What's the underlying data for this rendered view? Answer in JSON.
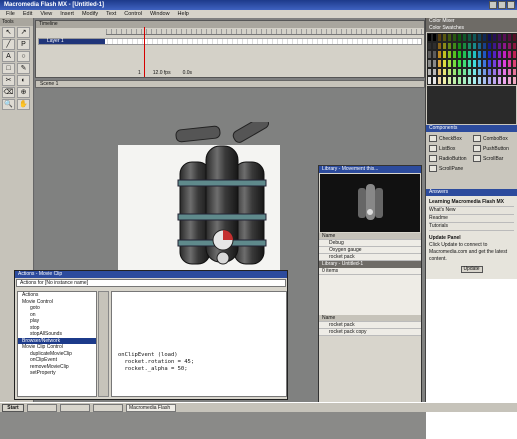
{
  "window": {
    "title": "Macromedia Flash MX - [Untitled-1]"
  },
  "menu": [
    "File",
    "Edit",
    "View",
    "Insert",
    "Modify",
    "Text",
    "Control",
    "Window",
    "Help"
  ],
  "tools": {
    "label": "Tools",
    "glyphs": [
      "↖",
      "↗",
      "╱",
      "P",
      "A",
      "○",
      "□",
      "✎",
      "✂",
      "◐",
      "⌫",
      "⊕",
      "🔍",
      "✋"
    ]
  },
  "timeline": {
    "label": "Timeline",
    "layer": "Layer 1",
    "status": [
      "1",
      "12.0 fps",
      "0.0s"
    ]
  },
  "stage_bar": {
    "scene": "Scene 1"
  },
  "panels": {
    "color_mixer": "Color Mixer",
    "color_swatches": "Color Swatches",
    "components": "Components",
    "component_items": [
      "CheckBox",
      "ComboBox",
      "ListBox",
      "PushButton",
      "RadioButton",
      "ScrollBar",
      "ScrollPane"
    ],
    "answers": "Answers",
    "answers_rows": [
      "Learning Macromedia Flash MX",
      "What's New",
      "Readme",
      "Tutorials"
    ],
    "answers_note_title": "Update Panel",
    "answers_note": "Click Update to connect to Macromedia.com and get the latest content.",
    "update_label": "Update"
  },
  "library": {
    "title": "Library - Movement this...",
    "header_name": "Name",
    "items": [
      "Debug",
      "Oxygen gauge",
      "rocket pack"
    ],
    "second_title": "Library - Untitled-1",
    "second_count": "0 items",
    "third_header": "Name",
    "third_items": [
      "rocket pack",
      "rocket pack copy"
    ]
  },
  "actions": {
    "title": "Actions - Movie Clip",
    "selector": "Actions for [No instance name]",
    "tree": [
      {
        "label": "Actions",
        "cat": true
      },
      {
        "label": "Movie Control",
        "cat": true
      },
      {
        "label": "goto",
        "cat": false
      },
      {
        "label": "on",
        "cat": false
      },
      {
        "label": "play",
        "cat": false
      },
      {
        "label": "stop",
        "cat": false
      },
      {
        "label": "stopAllSounds",
        "cat": false
      },
      {
        "label": "Browser/Network",
        "cat": true,
        "sel": true
      },
      {
        "label": "Movie Clip Control",
        "cat": true
      },
      {
        "label": "duplicateMovieClip",
        "cat": false
      },
      {
        "label": "onClipEvent",
        "cat": false
      },
      {
        "label": "removeMovieClip",
        "cat": false
      },
      {
        "label": "setProperty",
        "cat": false
      }
    ],
    "script": "onClipEvent (load)\n  rocket.rotation = 45;\n  rocket._alpha = 50;"
  },
  "taskbar": {
    "start": "Start",
    "tasks": [
      "",
      "",
      "",
      "Macromedia Flash"
    ]
  },
  "colors": {
    "accent": "#2c4b9d",
    "stage": "#f4f4f2",
    "workspace": "#7e7f80"
  }
}
